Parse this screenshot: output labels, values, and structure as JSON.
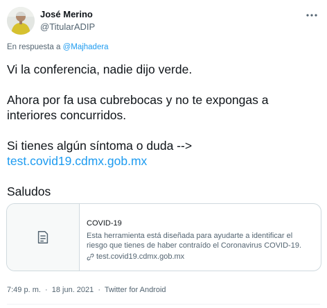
{
  "user": {
    "display_name": "José Merino",
    "handle": "@TitularADIP",
    "avatar_icon": "person-photo"
  },
  "more_icon": "ellipsis-icon",
  "reply": {
    "prefix": "En respuesta a",
    "mention": "@Majhadera"
  },
  "tweet": {
    "line1": "Vi la conferencia, nadie dijo verde.",
    "line2": "Ahora por fa usa cubrebocas y no te expongas a interiores concurridos.",
    "line3": "Si tienes algún síntoma o duda -->",
    "link": "test.covid19.cdmx.gob.mx",
    "line4": "Saludos"
  },
  "card": {
    "thumb_icon": "document-icon",
    "title": "COVID-19",
    "description": "Esta herramienta está diseñada para ayudarte a identificar el riesgo que tienes de haber contraído el Coronavirus COVID-19.",
    "domain_icon": "link-icon",
    "domain": "test.covid19.cdmx.gob.mx"
  },
  "meta": {
    "time": "7:49 p. m.",
    "date": "18 jun. 2021",
    "source": "Twitter for Android",
    "separator": "·"
  },
  "colors": {
    "accent": "#1d9bf0",
    "text": "#0f1419",
    "secondary": "#536471",
    "border": "#cfd9de"
  }
}
